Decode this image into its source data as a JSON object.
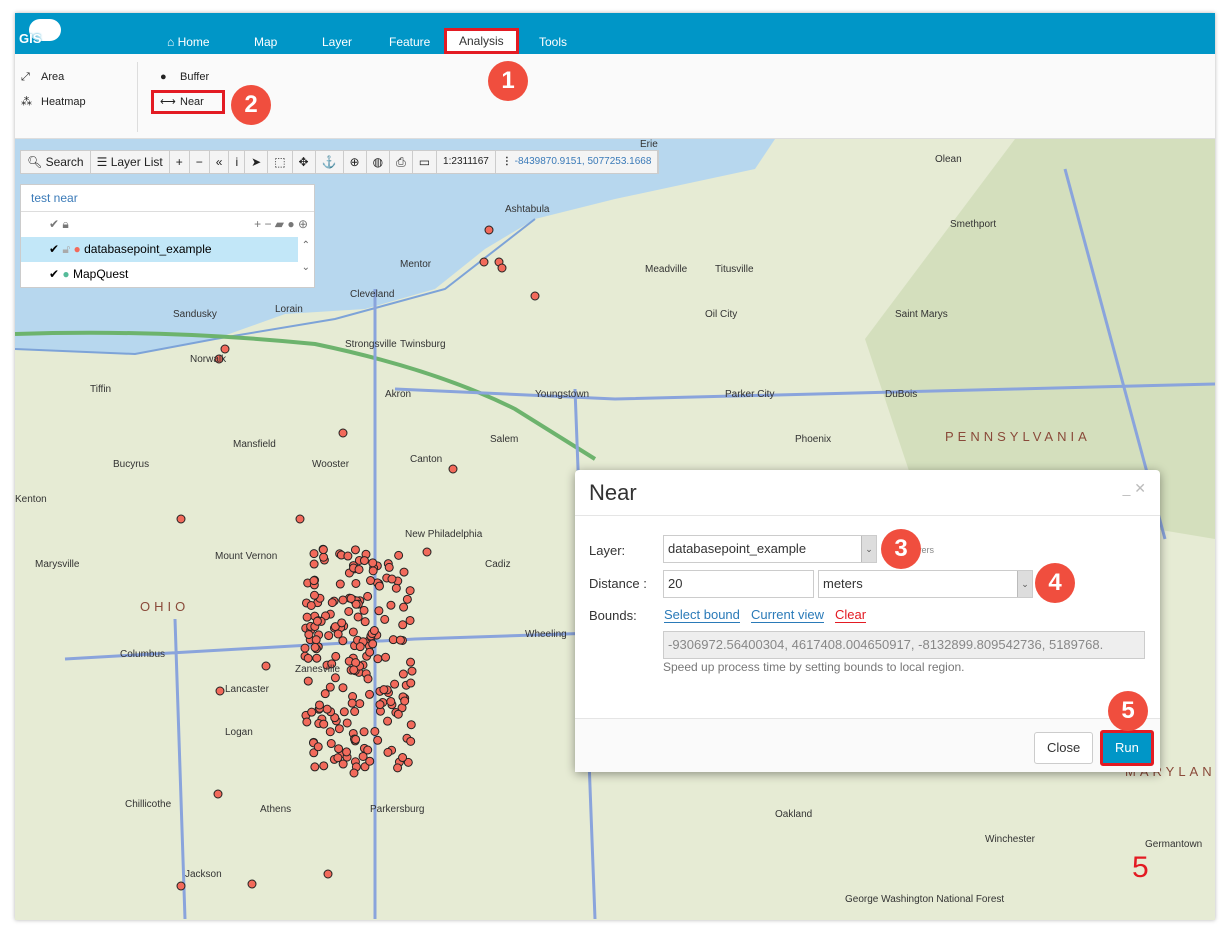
{
  "app": {
    "logo": "GIS"
  },
  "nav": {
    "items": [
      {
        "label": "Home"
      },
      {
        "label": "Map"
      },
      {
        "label": "Layer"
      },
      {
        "label": "Feature"
      },
      {
        "label": "Analysis"
      },
      {
        "label": "Tools"
      }
    ],
    "active": "Analysis"
  },
  "ribbon": {
    "area": "Area",
    "heatmap": "Heatmap",
    "buffer": "Buffer",
    "near": "Near"
  },
  "badges": [
    "1",
    "2",
    "3",
    "4",
    "5",
    "5"
  ],
  "toolbar": {
    "search": "Search",
    "layer_list": "Layer List",
    "scale": "1:2311167",
    "coords": "-8439870.9151, 5077253.1668"
  },
  "layers": {
    "title": "test near",
    "items": [
      {
        "label": "databasepoint_example",
        "selected": true
      },
      {
        "label": "MapQuest",
        "selected": false
      }
    ]
  },
  "map": {
    "labels": [
      "Erie",
      "Ashtabula",
      "Mentor",
      "Cleveland",
      "Sandusky",
      "Akron",
      "Canton",
      "Youngstown",
      "Meadville",
      "Titusville",
      "Oil City",
      "Saint Marys",
      "Parker City",
      "DuBois",
      "Phoenix",
      "PENNSYLVANIA",
      "OHIO",
      "Columbus",
      "Mansfield",
      "Wooster",
      "Bucyrus",
      "Marysville",
      "Mount Vernon",
      "New Philadelphia",
      "Cadiz",
      "Wheeling",
      "Zanesville",
      "Lancaster",
      "Logan",
      "Athens",
      "Parkersburg",
      "Chillicothe",
      "Jackson",
      "Salem",
      "Twinsburg",
      "Strongsville",
      "Norwalk",
      "Tiffin",
      "Kenton",
      "Lorain",
      "Olean",
      "Smethport",
      "Winchester",
      "Germantown",
      "MARYLAND",
      "George Washington National Forest",
      "Oakland"
    ],
    "accent": "#0096c7",
    "point_color": "#f26a5b"
  },
  "dialog": {
    "title": "Near",
    "layer_label": "Layer:",
    "layer_value": "databasepoint_example",
    "layer_hint": "t layers",
    "distance_label": "Distance :",
    "distance_value": "20",
    "unit_value": "meters",
    "bounds_label": "Bounds:",
    "select_bound": "Select bound",
    "current_view": "Current view",
    "clear": "Clear",
    "bounds_value": "-9306972.56400304, 4617408.004650917, -8132899.809542736, 5189768.",
    "help": "Speed up process time by setting bounds to local region.",
    "close": "Close",
    "run": "Run"
  }
}
